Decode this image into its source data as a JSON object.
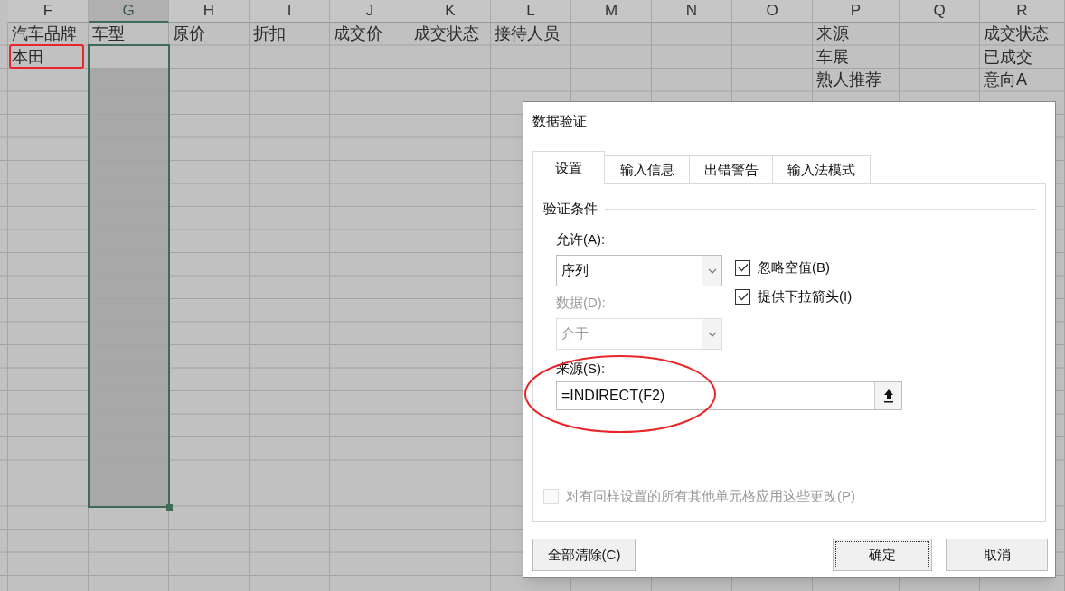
{
  "sheet": {
    "columns": [
      {
        "label": "F",
        "selected": false,
        "cells": [
          {
            "text": "汽车品牌",
            "marked": false
          },
          {
            "text": "本田",
            "marked": true
          }
        ]
      },
      {
        "label": "G",
        "selected": true,
        "cells": [
          {
            "text": "车型",
            "marked": false
          }
        ]
      },
      {
        "label": "H",
        "selected": false,
        "cells": [
          {
            "text": "原价",
            "marked": false
          }
        ]
      },
      {
        "label": "I",
        "selected": false,
        "cells": [
          {
            "text": "折扣",
            "marked": false
          }
        ]
      },
      {
        "label": "J",
        "selected": false,
        "cells": [
          {
            "text": "成交价",
            "marked": false
          }
        ]
      },
      {
        "label": "K",
        "selected": false,
        "cells": [
          {
            "text": "成交状态",
            "marked": false
          }
        ]
      },
      {
        "label": "L",
        "selected": false,
        "cells": [
          {
            "text": "接待人员",
            "marked": false
          }
        ]
      },
      {
        "label": "M",
        "selected": false
      },
      {
        "label": "N",
        "selected": false
      },
      {
        "label": "O",
        "selected": false
      },
      {
        "label": "P",
        "selected": false,
        "cells": [
          {
            "text": "来源",
            "marked": false
          },
          {
            "text": "车展",
            "marked": false
          },
          {
            "text": "熟人推荐",
            "marked": false
          }
        ]
      },
      {
        "label": "Q",
        "selected": false
      },
      {
        "label": "R",
        "selected": false,
        "cells": [
          {
            "text": "成交状态",
            "marked": false
          },
          {
            "text": "已成交",
            "marked": false
          },
          {
            "text": "意向A",
            "marked": false
          }
        ]
      }
    ]
  },
  "dialog": {
    "title": "数据验证",
    "tabs": [
      {
        "label": "设置",
        "selected": true
      },
      {
        "label": "输入信息",
        "selected": false
      },
      {
        "label": "出错警告",
        "selected": false
      },
      {
        "label": "输入法模式",
        "selected": false
      }
    ],
    "group_label": "验证条件",
    "allow": {
      "label": "允许(A):",
      "value": "序列",
      "disabled": false
    },
    "data": {
      "label": "数据(D):",
      "value": "介于",
      "disabled": true
    },
    "checkboxes": [
      {
        "label": "忽略空值(B)",
        "checked": true,
        "disabled": false
      },
      {
        "label": "提供下拉箭头(I)",
        "checked": true,
        "disabled": false
      }
    ],
    "source": {
      "label": "来源(S):",
      "value": "=INDIRECT(F2)",
      "circled": true
    },
    "apply_all": {
      "label": "对有同样设置的所有其他单元格应用这些更改(P)",
      "checked": false,
      "disabled": true
    },
    "buttons": [
      {
        "label": "全部清除(C)",
        "kind": "left"
      },
      {
        "label": "确定",
        "kind": "default"
      },
      {
        "label": "取消",
        "kind": "normal"
      }
    ]
  }
}
